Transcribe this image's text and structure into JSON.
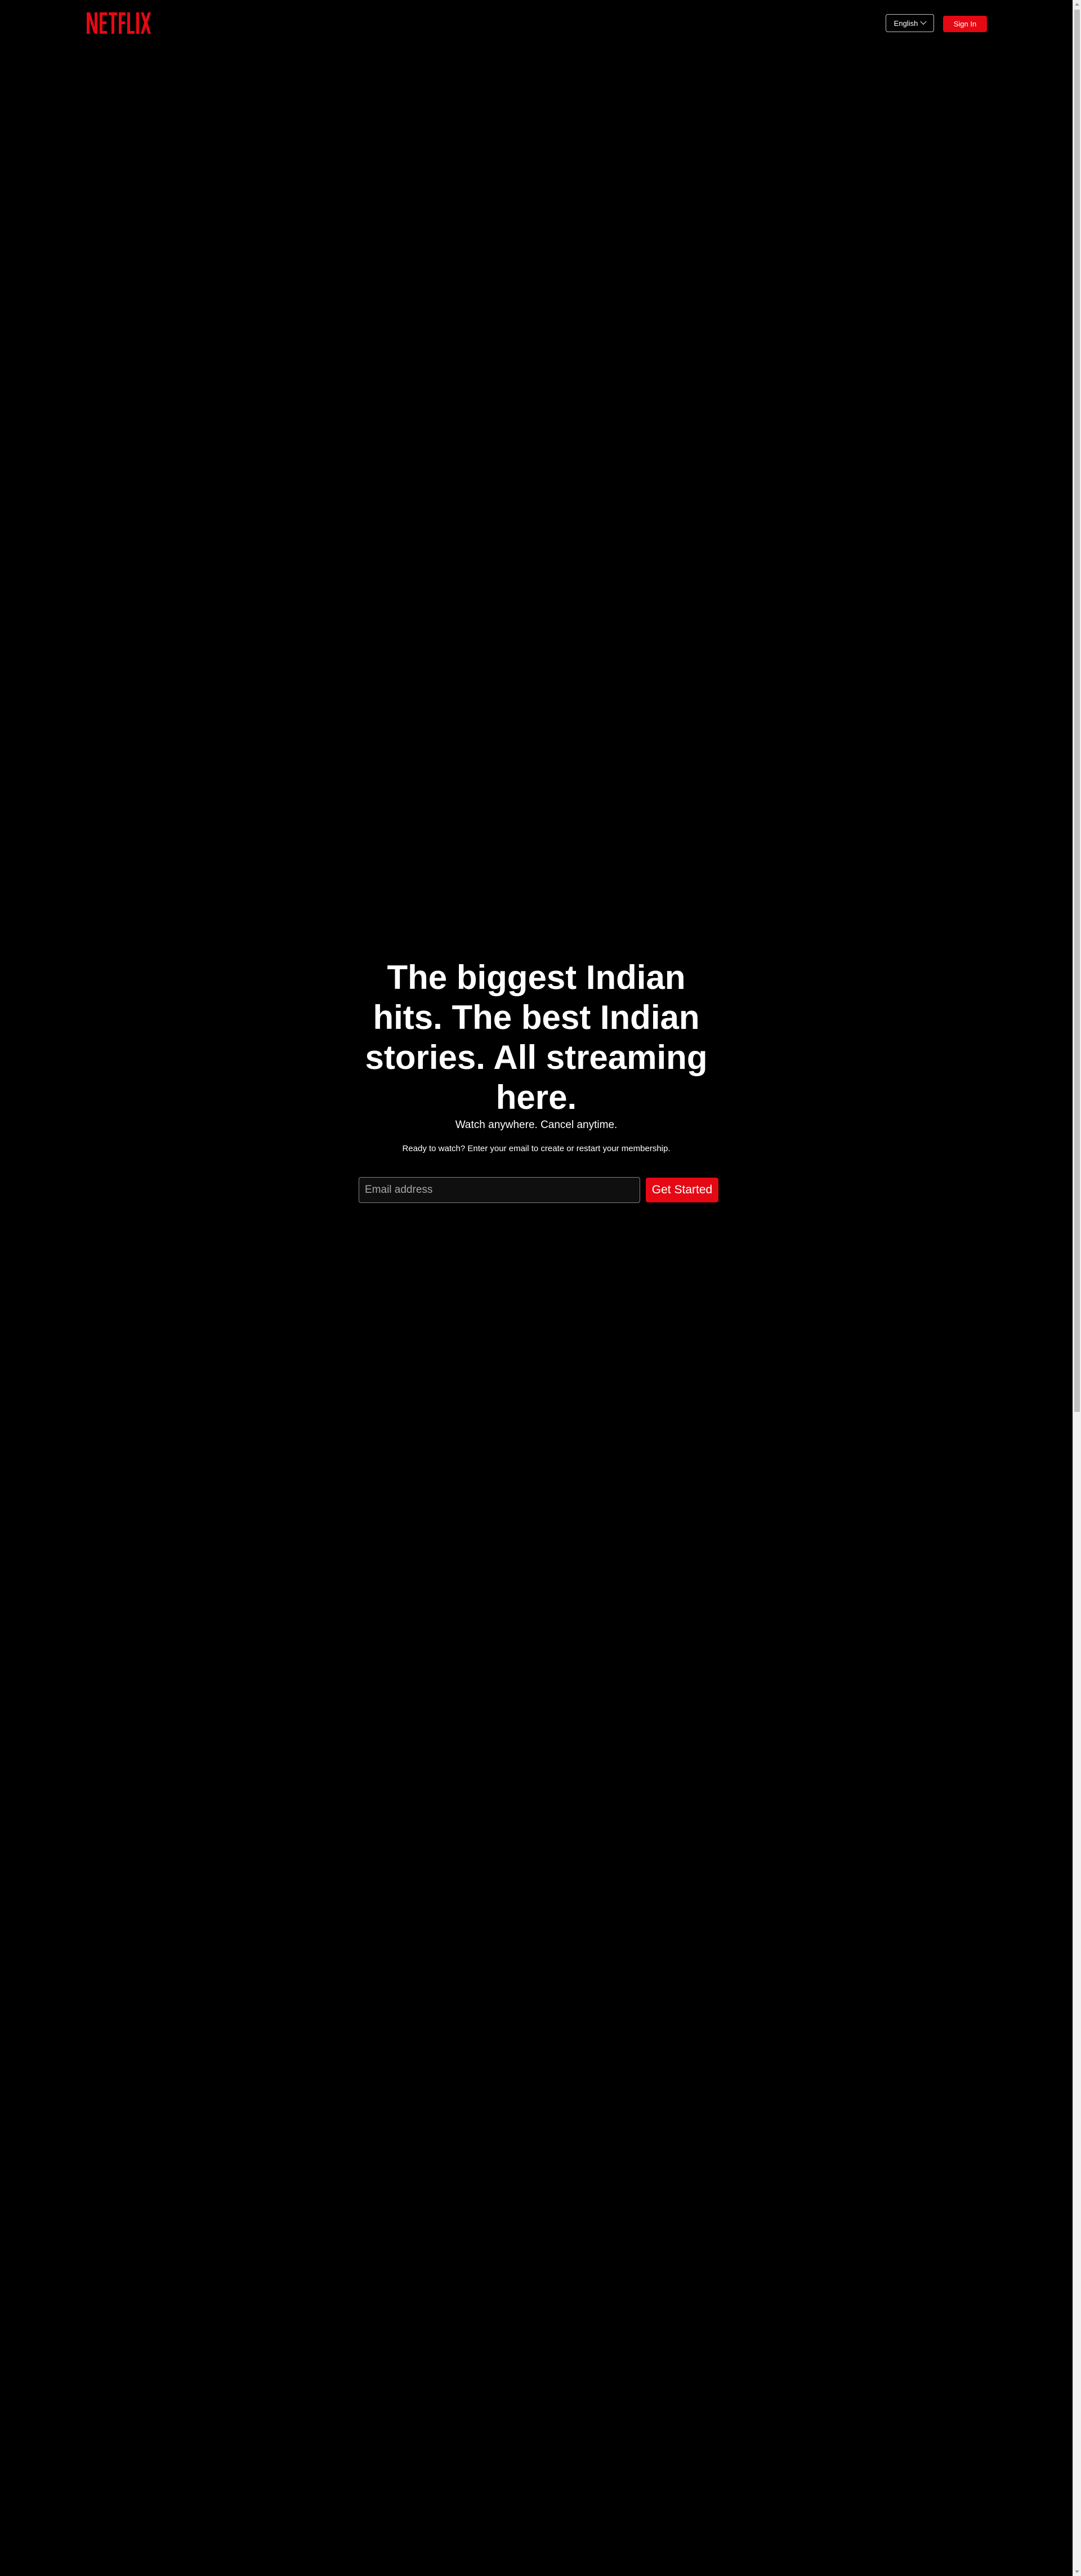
{
  "header": {
    "logo_text": "NETFLIX",
    "language_select": {
      "selected": "English"
    },
    "signin_label": "Sign In"
  },
  "hero": {
    "title": "The biggest Indian hits. The best Indian stories. All streaming here.",
    "subtitle": "Watch anywhere. Cancel anytime.",
    "cta_text": "Ready to watch? Enter your email to create or restart your membership.",
    "email_placeholder": "Email address",
    "get_started_label": "Get Started"
  },
  "colors": {
    "background": "#000000",
    "brand_red": "#e50914",
    "text": "#ffffff"
  },
  "icons": {
    "language_chevron": "chevron-down-icon"
  }
}
